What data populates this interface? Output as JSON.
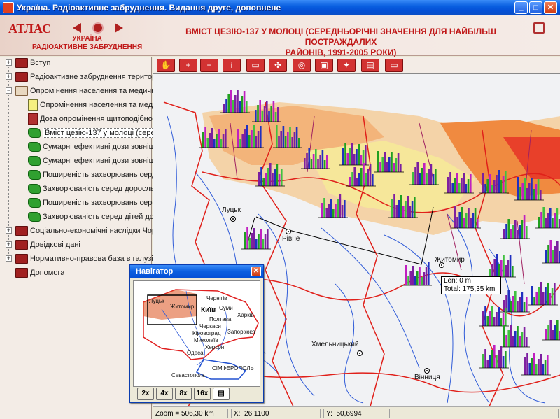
{
  "window": {
    "title": "Україна. Радіоактивне забруднення. Видання друге, доповнене",
    "min_label": "_",
    "max_label": "□",
    "close_label": "✕"
  },
  "header": {
    "logo_title": "АТЛАС",
    "logo_sub_1": "УКРАЇНА",
    "logo_sub_2": "РАДІОАКТИВНЕ ЗАБРУДНЕННЯ",
    "heading_line_1": "ВМІСТ ЦЕЗІЮ-137 У МОЛОЦІ (СЕРЕДНЬОРІЧНІ ЗНАЧЕННЯ ДЛЯ НАЙБІЛЬШ ПОСТРАЖДАЛИХ",
    "heading_line_2": "РАЙОНІВ, 1991-2005 РОКИ)",
    "accent": "#c01818"
  },
  "tree": {
    "items": [
      {
        "label": "Вступ"
      },
      {
        "label": "Радіоактивне забруднення територ"
      },
      {
        "label": "Опромінення населення та медичні"
      },
      {
        "label": "Опромінення населення та меди"
      },
      {
        "label": "Доза опромінення щитоподібно"
      },
      {
        "label": "Вміст цезію-137 у молоці (сере,"
      },
      {
        "label": "Сумарні ефективні дози зовніш"
      },
      {
        "label": "Сумарні ефективні дози зовніш"
      },
      {
        "label": "Поширеність захворювань серд"
      },
      {
        "label": "Захворюваність серед доросль"
      },
      {
        "label": "Поширеність захворювань серс"
      },
      {
        "label": "Захворюваність серед дітей дс"
      },
      {
        "label": "Соціально-економічні наслідки Чорн"
      },
      {
        "label": "Довідкові дані"
      },
      {
        "label": "Нормативно-правова база в галузі р"
      },
      {
        "label": "Допомога"
      }
    ]
  },
  "toolbar": {
    "tools": [
      {
        "icon": "hand-icon",
        "glyph": "✋"
      },
      {
        "icon": "zoom-in-icon",
        "glyph": "+"
      },
      {
        "icon": "zoom-out-icon",
        "glyph": "−"
      },
      {
        "icon": "info-icon",
        "glyph": "i"
      },
      {
        "icon": "legend-icon",
        "glyph": "▭"
      },
      {
        "icon": "full-extent-icon",
        "glyph": "✣"
      },
      {
        "icon": "measure-icon",
        "glyph": "◎"
      },
      {
        "icon": "layers-icon",
        "glyph": "▣"
      },
      {
        "icon": "navigator-icon",
        "glyph": "✦"
      },
      {
        "icon": "table-icon",
        "glyph": "▤"
      },
      {
        "icon": "print-icon",
        "glyph": "▭"
      }
    ]
  },
  "map": {
    "cities": {
      "lutsk": "Луцьк",
      "rivne": "Рівне",
      "zhytomyr": "Житомир",
      "khmelnytskyi": "Хмельницький",
      "vinnytsia": "Вінниця"
    },
    "tooltip": {
      "len": "Len:      0   m",
      "total": "Total:  175,35  km"
    }
  },
  "status": {
    "zoom": "Zoom = 506,30 km",
    "x_label": "X:",
    "x_value": "26,1100",
    "y_label": "Y:",
    "y_value": "50,6994"
  },
  "navigator": {
    "title": "Навігатор",
    "close_label": "✕",
    "zoom_buttons": [
      "2x",
      "4x",
      "8x",
      "16x"
    ],
    "cities": [
      "Луцьк",
      "Житомир",
      "Чернігів",
      "Київ",
      "Суми",
      "Харків",
      "Полтава",
      "Черкаси",
      "Запоріжжя",
      "Кіровоград",
      "Миколаїв",
      "Херсон",
      "Одеса",
      "Севастополь",
      "СІМФЕРОПОЛЬ"
    ]
  }
}
